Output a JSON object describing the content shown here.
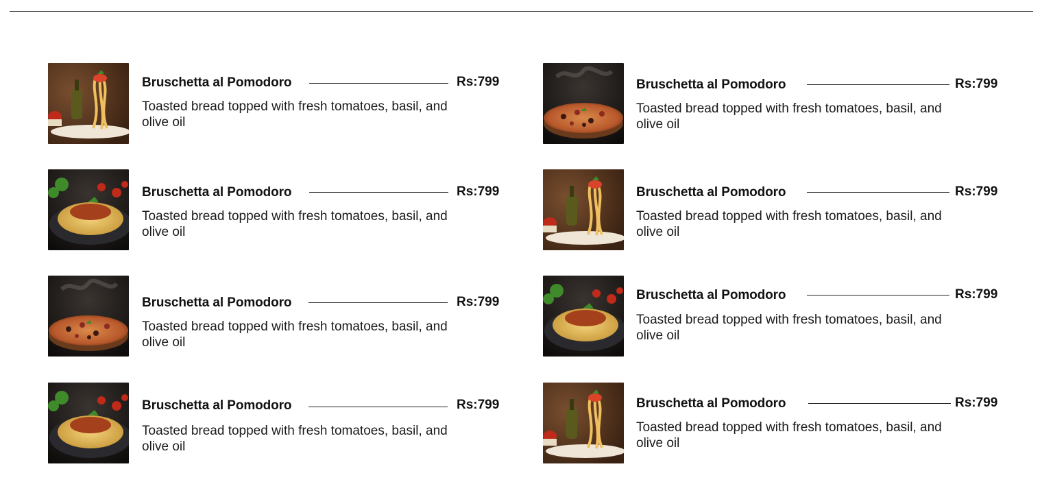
{
  "colors": {
    "background": "#ffffff",
    "text": "#111111",
    "rule": "#222222"
  },
  "menu": {
    "items": [
      {
        "name": "Bruschetta al Pomodoro",
        "price": "Rs:799",
        "description": "Toasted bread topped with fresh tomatoes, basil, and olive oil",
        "image": "spaghetti-fork-photo"
      },
      {
        "name": "Bruschetta al Pomodoro",
        "price": "Rs:799",
        "description": "Toasted bread topped with fresh tomatoes, basil, and olive oil",
        "image": "pizza-photo"
      },
      {
        "name": "Bruschetta al Pomodoro",
        "price": "Rs:799",
        "description": "Toasted bread topped with fresh tomatoes, basil, and olive oil",
        "image": "spaghetti-bolognese-photo"
      },
      {
        "name": "Bruschetta al Pomodoro",
        "price": "Rs:799",
        "description": "Toasted bread topped with fresh tomatoes, basil, and olive oil",
        "image": "spaghetti-fork-photo"
      },
      {
        "name": "Bruschetta al Pomodoro",
        "price": "Rs:799",
        "description": "Toasted bread topped with fresh tomatoes, basil, and olive oil",
        "image": "pizza-photo"
      },
      {
        "name": "Bruschetta al Pomodoro",
        "price": "Rs:799",
        "description": "Toasted bread topped with fresh tomatoes, basil, and olive oil",
        "image": "spaghetti-bolognese-photo"
      },
      {
        "name": "Bruschetta al Pomodoro",
        "price": "Rs:799",
        "description": "Toasted bread topped with fresh tomatoes, basil, and olive oil",
        "image": "spaghetti-bolognese-photo"
      },
      {
        "name": "Bruschetta al Pomodoro",
        "price": "Rs:799",
        "description": "Toasted bread topped with fresh tomatoes, basil, and olive oil",
        "image": "spaghetti-fork-photo"
      }
    ]
  }
}
